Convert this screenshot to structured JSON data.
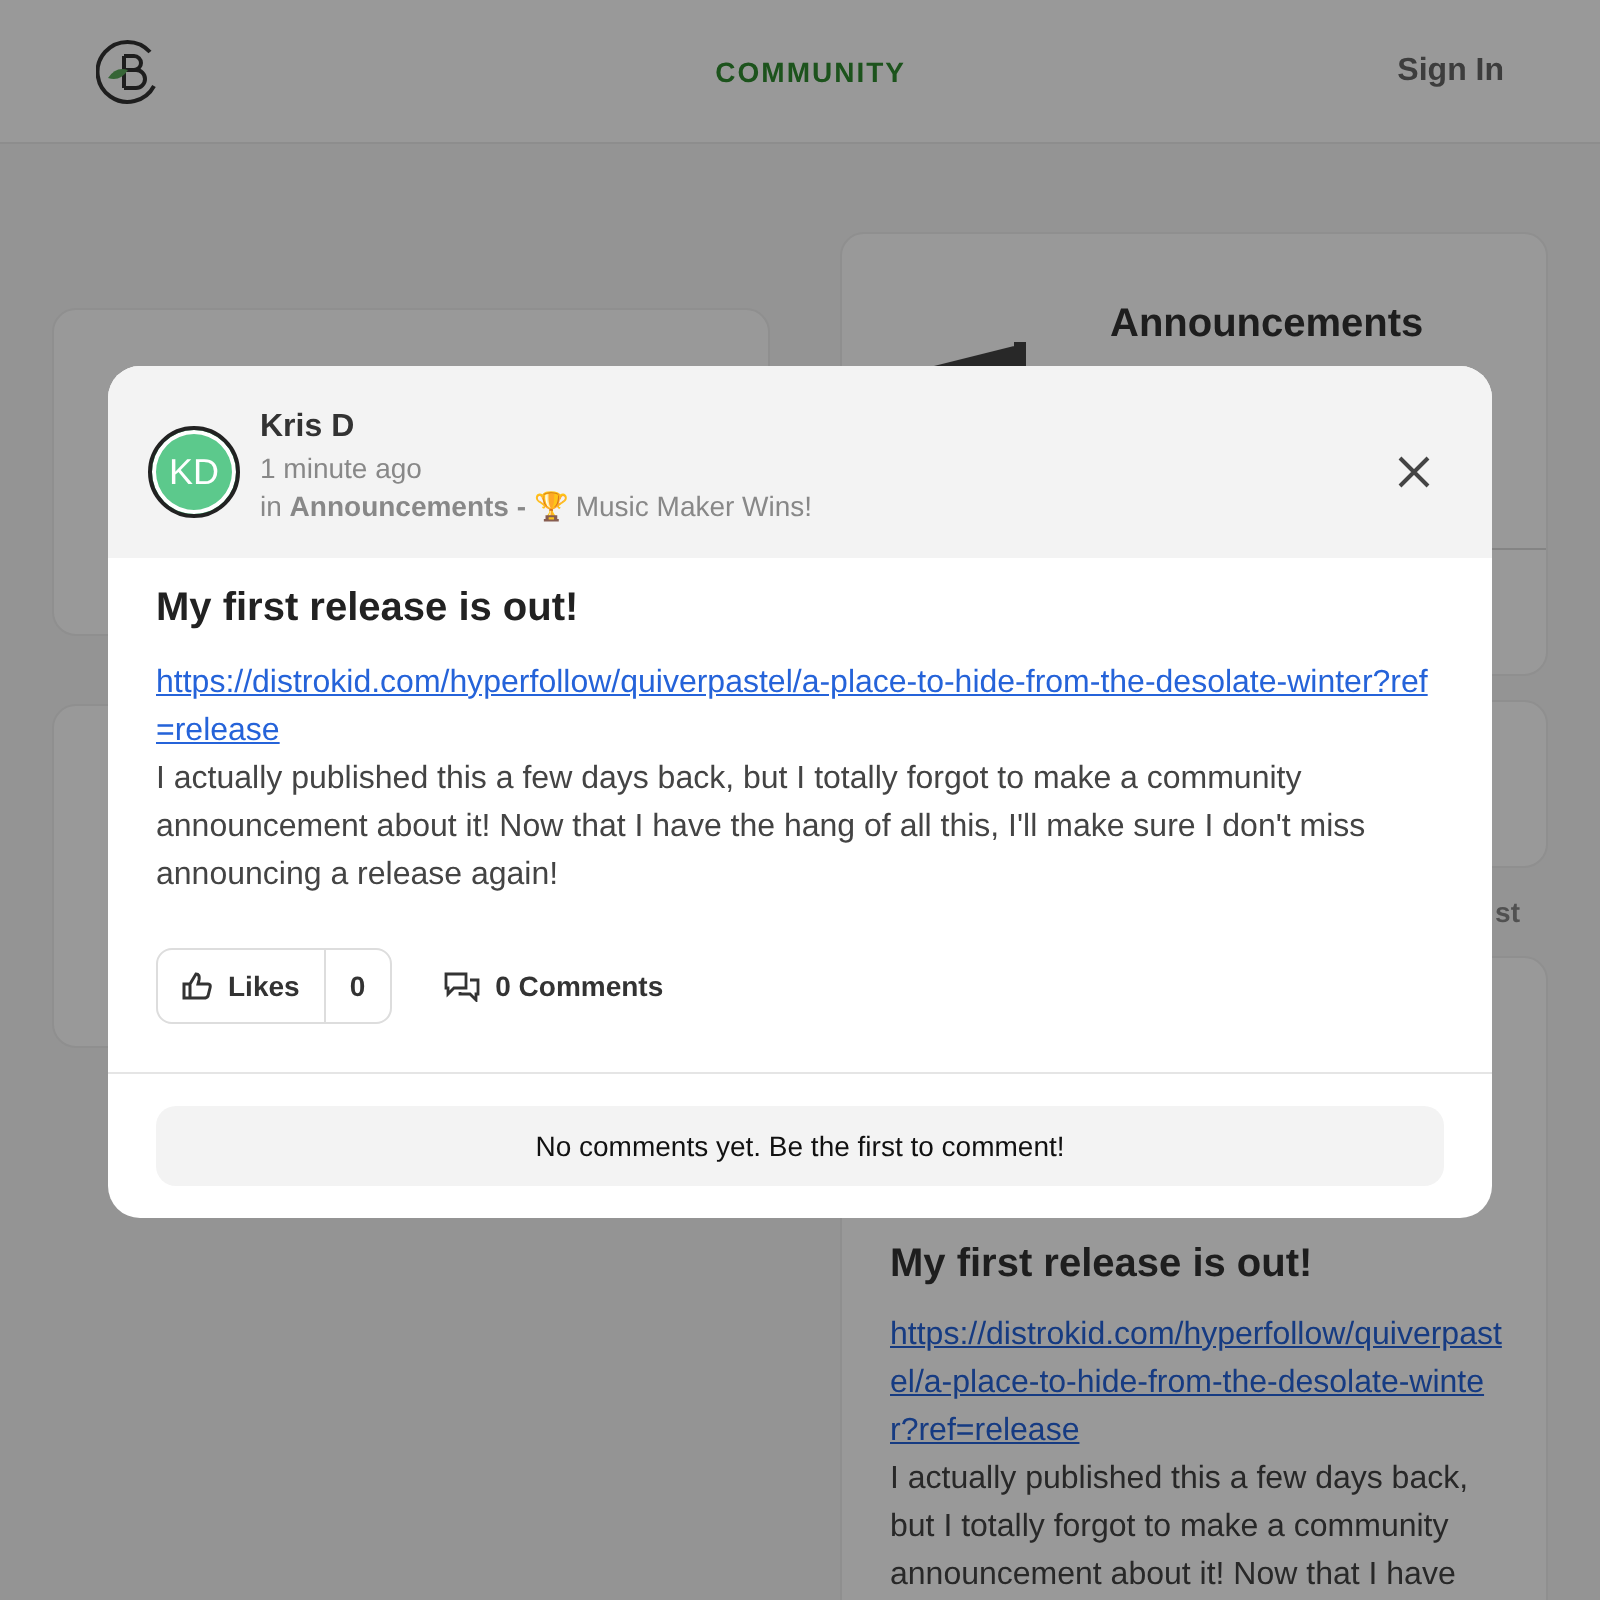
{
  "nav": {
    "center_link": "COMMUNITY",
    "sign_in": "Sign In"
  },
  "background": {
    "category_card": {
      "title": "Announcements"
    },
    "tab_fragment": "st",
    "post_card": {
      "title": "My first release is out!",
      "link": "https://distrokid.com/hyperfollow/quiverpastel/a-place-to-hide-from-the-desolate-winter?ref=release",
      "body": "I actually published this a few days back, but I totally forgot to make a community announcement about it! Now that I have"
    }
  },
  "modal": {
    "author": "Kris D",
    "initials": "KD",
    "time": "1 minute ago",
    "in_prefix": "in",
    "category": "Announcements",
    "separator": "-",
    "subcategory": "🏆 Music Maker Wins!",
    "title": "My first release is out!",
    "link": "https://distrokid.com/hyperfollow/quiverpastel/a-place-to-hide-from-the-desolate-winter?ref=release",
    "body": "I actually published this a few days back, but I totally forgot to make a community announcement about it! Now that I have the hang of all this, I'll make sure I don't miss announcing a release again!",
    "likes_label": "Likes",
    "likes_count": "0",
    "comments_label": "0 Comments",
    "empty_comments": "No comments yet. Be the first to comment!"
  }
}
